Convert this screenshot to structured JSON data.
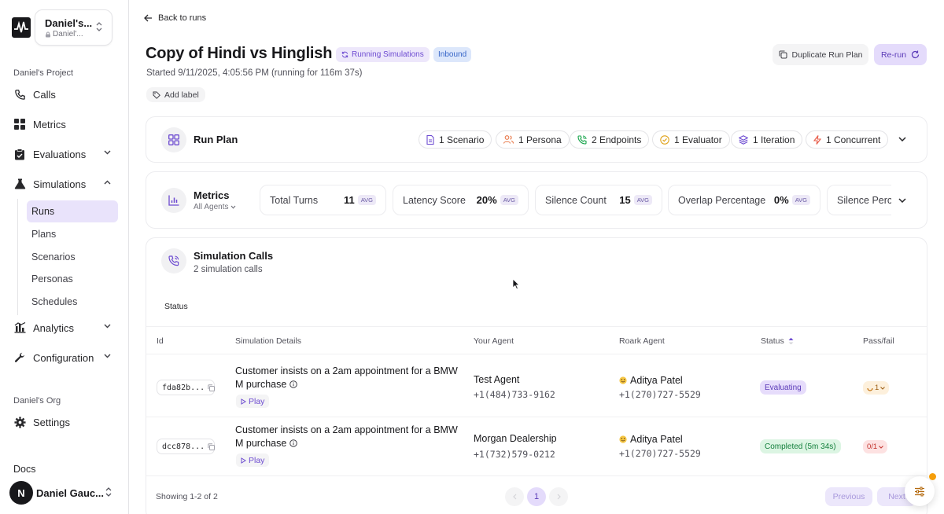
{
  "sidebar": {
    "workspace": {
      "name": "Daniel's...",
      "sub": "Daniel'..."
    },
    "project_label": "Daniel's Project",
    "items": [
      {
        "label": "Calls"
      },
      {
        "label": "Metrics"
      },
      {
        "label": "Evaluations"
      },
      {
        "label": "Simulations"
      },
      {
        "label": "Analytics"
      },
      {
        "label": "Configuration"
      }
    ],
    "sim_sub": [
      "Runs",
      "Plans",
      "Scenarios",
      "Personas",
      "Schedules"
    ],
    "org_label": "Daniel's Org",
    "settings": "Settings",
    "docs": "Docs",
    "user": {
      "initial": "N",
      "name": "Daniel Gauc..."
    }
  },
  "header": {
    "back": "Back to runs",
    "title": "Copy of Hindi vs Hinglish",
    "status_badge": "Running Simulations",
    "type_badge": "Inbound",
    "started": "Started 9/11/2025, 4:05:56 PM (running for 116m 37s)",
    "add_label": "Add label",
    "duplicate": "Duplicate Run Plan",
    "rerun": "Re-run"
  },
  "run_plan": {
    "title": "Run Plan",
    "pills": [
      "1 Scenario",
      "1 Persona",
      "2 Endpoints",
      "1 Evaluator",
      "1 Iteration",
      "1 Concurrent"
    ]
  },
  "metrics": {
    "title": "Metrics",
    "filter": "All Agents",
    "avg": "AVG",
    "cards": [
      {
        "label": "Total Turns",
        "value": "11"
      },
      {
        "label": "Latency Score",
        "value": "20%"
      },
      {
        "label": "Silence Count",
        "value": "15"
      },
      {
        "label": "Overlap Percentage",
        "value": "0%"
      },
      {
        "label": "Silence Perc"
      }
    ]
  },
  "calls": {
    "title": "Simulation Calls",
    "subtitle": "2 simulation calls",
    "filter": "Status",
    "columns": [
      "Id",
      "Simulation Details",
      "Your Agent",
      "Roark Agent",
      "Status",
      "Pass/fail"
    ],
    "play": "Play",
    "rows": [
      {
        "id": "fda82b...",
        "details": "Customer insists on a 2am appointment for a BMW M purchase",
        "agent": "Test Agent",
        "agent_phone": "+1(484)733-9162",
        "roark": "Aditya Patel",
        "roark_phone": "+1(270)727-5529",
        "status": "Evaluating",
        "passfail": "1"
      },
      {
        "id": "dcc878...",
        "details": "Customer insists on a 2am appointment for a BMW M purchase",
        "agent": "Morgan Dealership",
        "agent_phone": "+1(732)579-0212",
        "roark": "Aditya Patel",
        "roark_phone": "+1(270)727-5529",
        "status": "Completed (5m 34s)",
        "passfail": "0/1"
      }
    ],
    "footer": {
      "showing": "Showing 1-2 of 2",
      "page": "1",
      "previous": "Previous",
      "next": "Next"
    }
  },
  "colors": {
    "accent": "#6d4bd1",
    "active_bg": "#e9e3fb"
  }
}
